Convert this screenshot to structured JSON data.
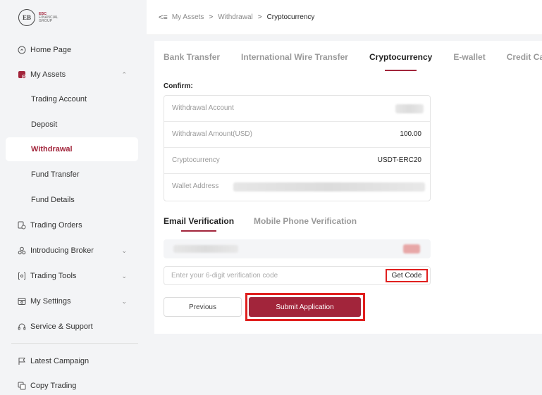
{
  "logo": {
    "mark": "EB",
    "line1": "EBC",
    "line2": "FINANCIAL",
    "line3": "GROUP"
  },
  "sidebar": {
    "items": [
      {
        "label": "Home Page",
        "icon": "home-icon"
      },
      {
        "label": "My Assets",
        "icon": "assets-icon",
        "expanded": true
      },
      {
        "label": "Trading Account"
      },
      {
        "label": "Deposit"
      },
      {
        "label": "Withdrawal",
        "active": true
      },
      {
        "label": "Fund Transfer"
      },
      {
        "label": "Fund Details"
      },
      {
        "label": "Trading Orders",
        "icon": "orders-icon"
      },
      {
        "label": "Introducing Broker",
        "icon": "broker-icon"
      },
      {
        "label": "Trading Tools",
        "icon": "tools-icon"
      },
      {
        "label": "My Settings",
        "icon": "settings-icon"
      },
      {
        "label": "Service & Support",
        "icon": "support-icon"
      },
      {
        "label": "Latest Campaign",
        "icon": "campaign-icon"
      },
      {
        "label": "Copy Trading",
        "icon": "copy-trading-icon"
      }
    ]
  },
  "breadcrumb": {
    "items": [
      "My Assets",
      "Withdrawal",
      "Cryptocurrency"
    ]
  },
  "tabs": [
    "Bank Transfer",
    "International Wire Transfer",
    "Cryptocurrency",
    "E-wallet",
    "Credit Card"
  ],
  "active_tab": "Cryptocurrency",
  "confirm": {
    "title": "Confirm:",
    "rows": [
      {
        "key": "Withdrawal Account",
        "value": ""
      },
      {
        "key": "Withdrawal Amount(USD)",
        "value": "100.00"
      },
      {
        "key": "Cryptocurrency",
        "value": "USDT-ERC20"
      },
      {
        "key": "Wallet Address",
        "value": ""
      }
    ]
  },
  "verify_tabs": [
    "Email Verification",
    "Mobile Phone Verification"
  ],
  "code_input": {
    "placeholder": "Enter your 6-digit verification code",
    "value": ""
  },
  "buttons": {
    "get_code": "Get Code",
    "previous": "Previous",
    "submit": "Submit Application"
  },
  "colors": {
    "brand": "#a2253b",
    "highlight": "#e0201f"
  }
}
